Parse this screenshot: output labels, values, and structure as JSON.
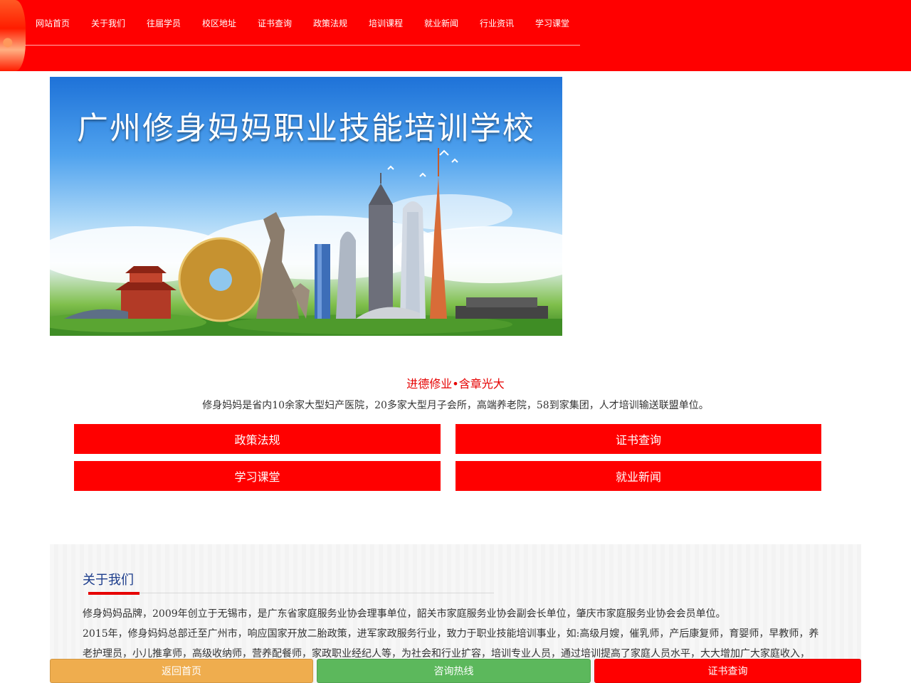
{
  "nav": {
    "items": [
      "网站首页",
      "关于我们",
      "往届学员",
      "校区地址",
      "证书查询",
      "政策法规",
      "培训课程",
      "就业新闻",
      "行业资讯",
      "学习课堂"
    ]
  },
  "banner": {
    "title": "广州修身妈妈职业技能培训学校"
  },
  "slogan": "进德修业•含章光大",
  "intro": "修身妈妈是省内10余家大型妇产医院，20多家大型月子会所，高端养老院，58到家集团，人才培训输送联盟单位。",
  "quick_links": {
    "policy": "政策法规",
    "certificate": "证书查询",
    "classroom": "学习课堂",
    "jobs": "就业新闻"
  },
  "about": {
    "title": "关于我们",
    "paragraph1": "修身妈妈品牌，2009年创立于无锡市，是广东省家庭服务业协会理事单位，韶关市家庭服务业协会副会长单位，肇庆市家庭服务业协会会员单位。",
    "paragraph2": "2015年，修身妈妈总部迁至广州市，响应国家开放二胎政策，进军家政服务行业，致力于职业技能培训事业，如:高级月嫂，催乳师，产后康复师，育婴师，早教师，养老护理员，小儿推拿师，高级收纳师，营养配餐师，家政职业经纪人等，为社会和行业扩容，培训专业人员，通过培训提高了家庭人员水平，大大增加广大家庭收入，"
  },
  "bottom_bar": {
    "home": "返回首页",
    "hotline": "咨询热线",
    "certificate": "证书查询"
  },
  "colors": {
    "brand_red": "#ff0000",
    "home_orange": "#efad4e",
    "hotline_green": "#5cb85c"
  }
}
